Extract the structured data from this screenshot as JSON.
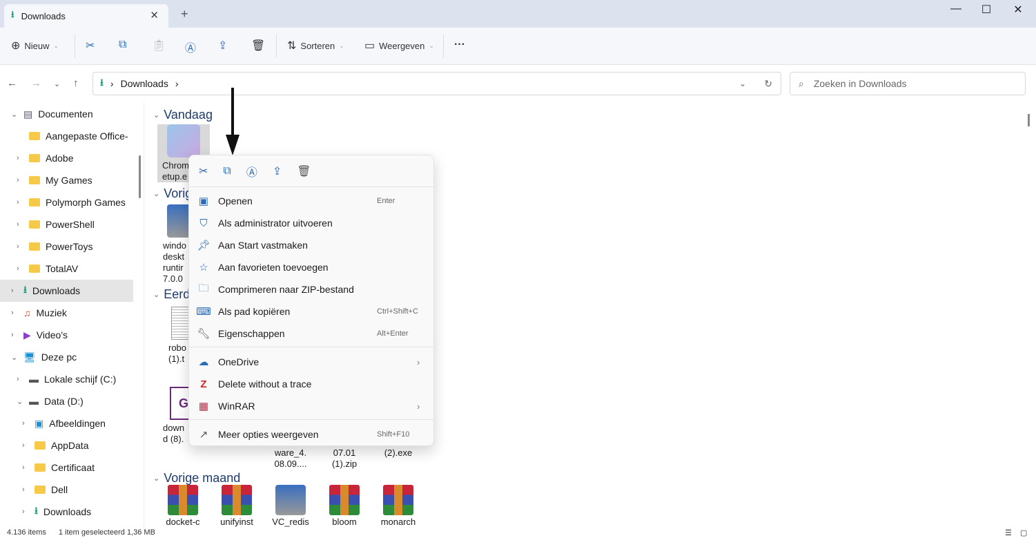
{
  "window": {
    "tab_title": "Downloads",
    "new_tab": "+",
    "minimize": "—",
    "maximize": "☐",
    "close": "✕"
  },
  "toolbar": {
    "new_label": "Nieuw",
    "sort_label": "Sorteren",
    "view_label": "Weergeven",
    "more": "···"
  },
  "address": {
    "crumbs": [
      "Downloads"
    ],
    "search_placeholder": "Zoeken in Downloads"
  },
  "sidebar": {
    "items": [
      {
        "label": "Documenten",
        "level": 0,
        "expanded": true
      },
      {
        "label": "Aangepaste Office-",
        "level": 1
      },
      {
        "label": "Adobe",
        "level": 1
      },
      {
        "label": "My Games",
        "level": 1
      },
      {
        "label": "Polymorph Games",
        "level": 1
      },
      {
        "label": "PowerShell",
        "level": 1
      },
      {
        "label": "PowerToys",
        "level": 1
      },
      {
        "label": "TotalAV",
        "level": 1
      },
      {
        "label": "Downloads",
        "level": 0,
        "selected": true
      },
      {
        "label": "Muziek",
        "level": 0
      },
      {
        "label": "Video's",
        "level": 0
      },
      {
        "label": "Deze pc",
        "level": 0,
        "expanded": true
      },
      {
        "label": "Lokale schijf (C:)",
        "level": 1
      },
      {
        "label": "Data (D:)",
        "level": 1,
        "expanded": true
      },
      {
        "label": "Afbeeldingen",
        "level": 2
      },
      {
        "label": "AppData",
        "level": 2
      },
      {
        "label": "Certificaat",
        "level": 2
      },
      {
        "label": "Dell",
        "level": 2
      },
      {
        "label": "Downloads",
        "level": 2
      }
    ]
  },
  "groups": [
    {
      "label": "Vandaag",
      "files": [
        {
          "name": "Chrom\netup.e"
        }
      ]
    },
    {
      "label": "Vorig",
      "files": [
        {
          "name": "windo\ndeskt\nruntir\n7.0.0"
        }
      ]
    },
    {
      "label": "Eerd",
      "files": [
        {
          "name": "robo\n(1).t"
        },
        {
          "name": "down\nd (8)."
        },
        {
          "name": "ware_4.\n08.09...."
        },
        {
          "name": "07.01\n(1).zip"
        },
        {
          "name": "(2).exe"
        }
      ]
    },
    {
      "label": "Vorige maand",
      "files": [
        {
          "name": "docket-c"
        },
        {
          "name": "unifyinst"
        },
        {
          "name": "VC_redis"
        },
        {
          "name": "bloom"
        },
        {
          "name": "monarch"
        }
      ]
    }
  ],
  "context_menu": {
    "quick_actions": [
      "cut",
      "copy",
      "rename",
      "share",
      "delete"
    ],
    "items": [
      {
        "label": "Openen",
        "shortcut": "Enter",
        "icon": "open-icon"
      },
      {
        "label": "Als administrator uitvoeren",
        "shortcut": "",
        "icon": "shield-icon"
      },
      {
        "label": "Aan Start vastmaken",
        "shortcut": "",
        "icon": "pin-icon"
      },
      {
        "label": "Aan favorieten toevoegen",
        "shortcut": "",
        "icon": "star-icon"
      },
      {
        "label": "Comprimeren naar ZIP-bestand",
        "shortcut": "",
        "icon": "zip-icon"
      },
      {
        "label": "Als pad kopiëren",
        "shortcut": "Ctrl+Shift+C",
        "icon": "path-icon"
      },
      {
        "label": "Eigenschappen",
        "shortcut": "Alt+Enter",
        "icon": "wrench-icon"
      },
      {
        "label": "OneDrive",
        "submenu": true,
        "icon": "cloud-icon"
      },
      {
        "label": "Delete without a trace",
        "icon": "zap-icon"
      },
      {
        "label": "WinRAR",
        "submenu": true,
        "icon": "winrar-icon"
      },
      {
        "label": "Meer opties weergeven",
        "shortcut": "Shift+F10",
        "icon": "more-options-icon"
      }
    ]
  },
  "status": {
    "count": "4.136 items",
    "selection": "1 item geselecteerd",
    "size": "1,36 MB"
  }
}
